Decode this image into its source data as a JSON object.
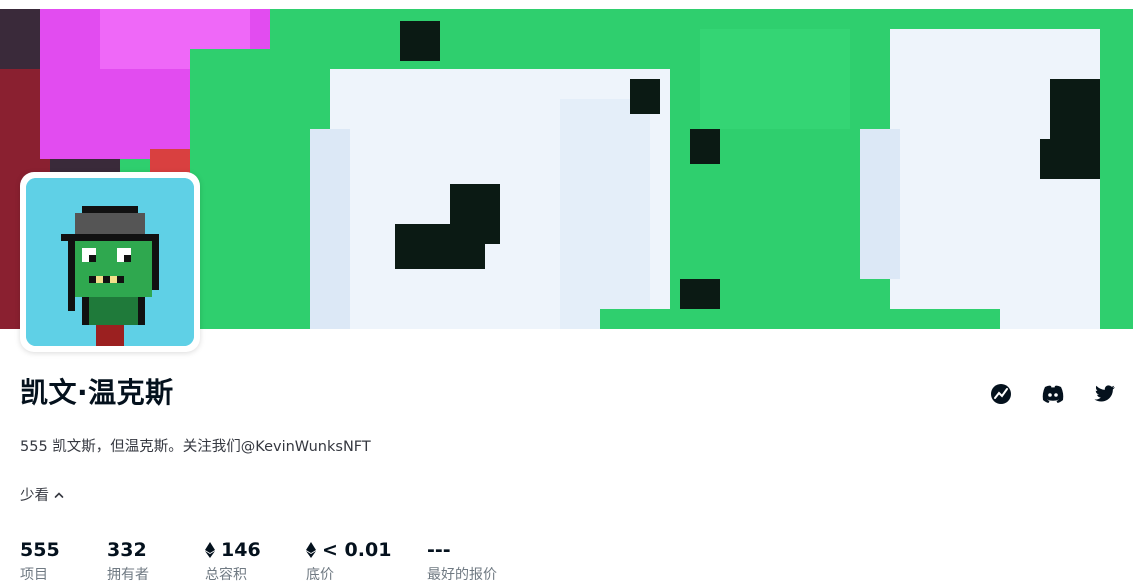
{
  "collection": {
    "title": "凯文·温克斯",
    "description": "555 凯文斯，但温克斯。关注我们@KevinWunksNFT",
    "toggle_label": "少看"
  },
  "socials": [
    {
      "icon": "chart-icon"
    },
    {
      "icon": "discord-icon"
    },
    {
      "icon": "twitter-icon"
    }
  ],
  "stats": [
    {
      "value": "555",
      "label": "项目",
      "eth": false
    },
    {
      "value": "332",
      "label": "拥有者",
      "eth": false
    },
    {
      "value": "146",
      "label": "总容积",
      "eth": true
    },
    {
      "value": "< 0.01",
      "label": "底价",
      "eth": true
    },
    {
      "value": "---",
      "label": "最好的报价",
      "eth": false
    }
  ],
  "colors": {
    "banner_green": "#2ecc71",
    "banner_white": "#e8f0f8",
    "banner_magenta": "#e040fb",
    "avatar_bg": "#5fd0e6",
    "text_primary": "#04111d",
    "text_secondary": "#707a83"
  }
}
